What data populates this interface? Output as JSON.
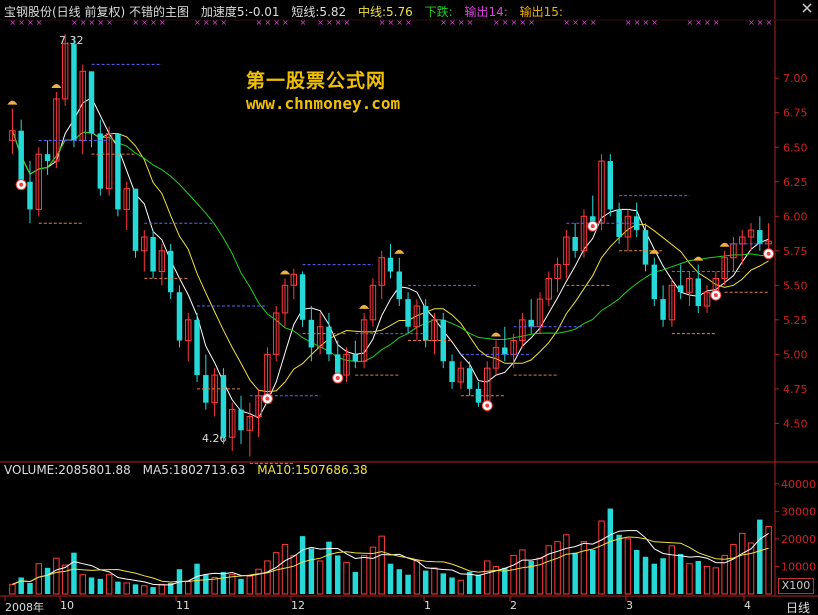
{
  "header": {
    "title": "宝钢股份(日线 前复权) 不错的主图",
    "accel": "加速度5:-0.01",
    "short": "短线:5.82",
    "mid": "中线:5.76",
    "trend": "下跌:",
    "out14": "输出14:",
    "out15": "输出15:"
  },
  "watermark": {
    "line1": "第一股票公式网",
    "line2": "www.chnmoney.com"
  },
  "annotations": {
    "high": "7.32",
    "low": "4.26"
  },
  "volume_header": {
    "volume": "VOLUME:2085801.88",
    "ma5": "MA5:1802713.63",
    "ma10": "MA10:1507686.38"
  },
  "x_labels": [
    "2008年",
    "10",
    "11",
    "12",
    "1",
    "2",
    "3",
    "4"
  ],
  "period": "日线",
  "vol_scale": "X100",
  "colors": {
    "up": "#ff3b3b",
    "down": "#26d9d9",
    "ma_short": "#ffffff",
    "ma_mid": "#f0e040",
    "ma_long": "#20d020",
    "axis": "#b02020",
    "purple": "#e040e0",
    "label_green": "#20d020",
    "label_yellow": "#f0e040",
    "label_mag": "#e040e0",
    "label_orange": "#f0b000"
  },
  "chart_data": [
    {
      "type": "candlestick",
      "ylim": [
        4.3,
        7.4
      ],
      "y_ticks": [
        "7.00",
        "6.75",
        "6.50",
        "6.25",
        "6.00",
        "5.75",
        "5.50",
        "5.25",
        "5.00",
        "4.75",
        "4.50"
      ],
      "ohlc": [
        [
          6.55,
          6.78,
          6.45,
          6.62
        ],
        [
          6.62,
          6.7,
          6.2,
          6.25
        ],
        [
          6.25,
          6.4,
          5.95,
          6.05
        ],
        [
          6.05,
          6.5,
          6.0,
          6.45
        ],
        [
          6.45,
          6.55,
          6.3,
          6.4
        ],
        [
          6.4,
          6.9,
          6.35,
          6.85
        ],
        [
          6.85,
          7.32,
          6.8,
          7.25
        ],
        [
          7.25,
          7.3,
          6.5,
          6.55
        ],
        [
          6.55,
          7.1,
          6.45,
          7.05
        ],
        [
          7.05,
          7.05,
          6.5,
          6.6
        ],
        [
          6.6,
          6.7,
          6.15,
          6.2
        ],
        [
          6.2,
          6.65,
          6.15,
          6.6
        ],
        [
          6.6,
          6.6,
          6.0,
          6.05
        ],
        [
          6.05,
          6.25,
          5.9,
          6.2
        ],
        [
          6.2,
          6.2,
          5.7,
          5.75
        ],
        [
          5.75,
          5.9,
          5.6,
          5.85
        ],
        [
          5.85,
          5.9,
          5.55,
          5.6
        ],
        [
          5.6,
          5.8,
          5.5,
          5.75
        ],
        [
          5.75,
          5.8,
          5.4,
          5.45
        ],
        [
          5.45,
          5.5,
          5.05,
          5.1
        ],
        [
          5.1,
          5.3,
          4.95,
          5.25
        ],
        [
          5.25,
          5.3,
          4.8,
          4.85
        ],
        [
          4.85,
          5.0,
          4.6,
          4.65
        ],
        [
          4.65,
          4.9,
          4.55,
          4.85
        ],
        [
          4.85,
          4.9,
          4.35,
          4.4
        ],
        [
          4.4,
          4.65,
          4.3,
          4.6
        ],
        [
          4.6,
          4.7,
          4.35,
          4.45
        ],
        [
          4.45,
          4.65,
          4.26,
          4.55
        ],
        [
          4.55,
          4.75,
          4.4,
          4.7
        ],
        [
          4.7,
          5.05,
          4.65,
          5.0
        ],
        [
          5.0,
          5.35,
          4.95,
          5.3
        ],
        [
          5.3,
          5.55,
          5.2,
          5.5
        ],
        [
          5.5,
          5.62,
          5.4,
          5.58
        ],
        [
          5.58,
          5.6,
          5.2,
          5.25
        ],
        [
          5.25,
          5.35,
          4.95,
          5.05
        ],
        [
          5.05,
          5.3,
          5.0,
          5.2
        ],
        [
          5.2,
          5.3,
          4.95,
          5.0
        ],
        [
          5.0,
          5.1,
          4.8,
          4.85
        ],
        [
          4.85,
          5.05,
          4.8,
          5.0
        ],
        [
          5.0,
          5.1,
          4.9,
          4.95
        ],
        [
          4.95,
          5.3,
          4.9,
          5.25
        ],
        [
          5.25,
          5.55,
          5.2,
          5.5
        ],
        [
          5.5,
          5.75,
          5.4,
          5.7
        ],
        [
          5.7,
          5.8,
          5.55,
          5.6
        ],
        [
          5.6,
          5.7,
          5.35,
          5.4
        ],
        [
          5.4,
          5.45,
          5.15,
          5.2
        ],
        [
          5.2,
          5.4,
          5.1,
          5.35
        ],
        [
          5.35,
          5.4,
          5.05,
          5.1
        ],
        [
          5.1,
          5.3,
          5.0,
          5.25
        ],
        [
          5.25,
          5.3,
          4.9,
          4.95
        ],
        [
          4.95,
          5.0,
          4.75,
          4.8
        ],
        [
          4.8,
          4.95,
          4.75,
          4.9
        ],
        [
          4.9,
          4.95,
          4.7,
          4.75
        ],
        [
          4.75,
          4.8,
          4.62,
          4.65
        ],
        [
          4.65,
          4.95,
          4.6,
          4.9
        ],
        [
          4.9,
          5.1,
          4.85,
          5.05
        ],
        [
          5.05,
          5.2,
          4.95,
          5.0
        ],
        [
          5.0,
          5.15,
          4.9,
          5.1
        ],
        [
          5.1,
          5.3,
          5.05,
          5.25
        ],
        [
          5.25,
          5.4,
          5.15,
          5.2
        ],
        [
          5.2,
          5.45,
          5.15,
          5.4
        ],
        [
          5.4,
          5.6,
          5.35,
          5.55
        ],
        [
          5.55,
          5.7,
          5.45,
          5.65
        ],
        [
          5.65,
          5.9,
          5.55,
          5.85
        ],
        [
          5.85,
          5.95,
          5.7,
          5.75
        ],
        [
          5.75,
          6.05,
          5.7,
          6.0
        ],
        [
          6.0,
          6.15,
          5.9,
          5.95
        ],
        [
          5.95,
          6.45,
          5.9,
          6.4
        ],
        [
          6.4,
          6.45,
          6.0,
          6.05
        ],
        [
          6.05,
          6.1,
          5.8,
          5.85
        ],
        [
          5.85,
          6.05,
          5.75,
          6.0
        ],
        [
          6.0,
          6.1,
          5.85,
          5.9
        ],
        [
          5.9,
          5.95,
          5.6,
          5.65
        ],
        [
          5.65,
          5.7,
          5.35,
          5.4
        ],
        [
          5.4,
          5.5,
          5.2,
          5.25
        ],
        [
          5.25,
          5.55,
          5.2,
          5.5
        ],
        [
          5.5,
          5.65,
          5.4,
          5.45
        ],
        [
          5.45,
          5.6,
          5.35,
          5.55
        ],
        [
          5.55,
          5.65,
          5.3,
          5.35
        ],
        [
          5.35,
          5.5,
          5.3,
          5.45
        ],
        [
          5.45,
          5.6,
          5.4,
          5.55
        ],
        [
          5.55,
          5.75,
          5.5,
          5.7
        ],
        [
          5.7,
          5.85,
          5.6,
          5.8
        ],
        [
          5.8,
          5.9,
          5.65,
          5.85
        ],
        [
          5.85,
          5.95,
          5.75,
          5.9
        ],
        [
          5.9,
          6.0,
          5.75,
          5.8
        ],
        [
          5.8,
          5.95,
          5.7,
          5.82
        ]
      ],
      "volume": [
        35,
        60,
        40,
        110,
        95,
        130,
        105,
        150,
        70,
        60,
        55,
        70,
        45,
        40,
        35,
        30,
        25,
        35,
        40,
        90,
        45,
        110,
        70,
        60,
        80,
        70,
        55,
        65,
        90,
        120,
        150,
        180,
        140,
        210,
        165,
        120,
        190,
        140,
        115,
        80,
        140,
        170,
        210,
        110,
        90,
        70,
        120,
        85,
        95,
        75,
        60,
        50,
        80,
        70,
        120,
        100,
        95,
        140,
        160,
        120,
        130,
        175,
        190,
        215,
        150,
        190,
        160,
        265,
        310,
        215,
        200,
        160,
        135,
        110,
        130,
        175,
        145,
        110,
        120,
        100,
        95,
        140,
        180,
        220,
        185,
        270,
        245
      ],
      "vol_ylim": [
        0,
        450
      ],
      "vol_ticks": [
        "40000",
        "30000",
        "20000",
        "10000"
      ],
      "ma_periods": [
        5,
        10,
        20
      ]
    }
  ]
}
